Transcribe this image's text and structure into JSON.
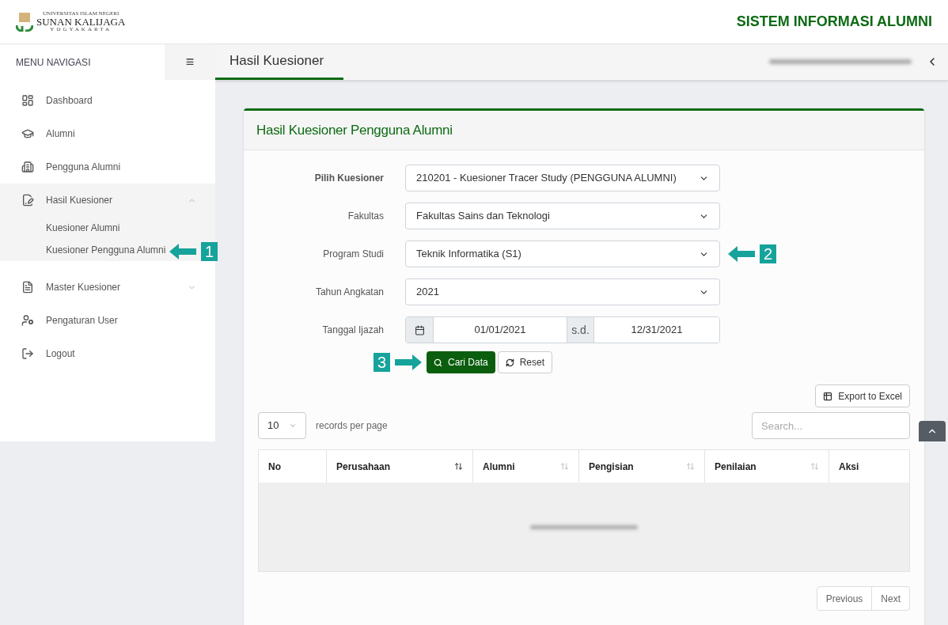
{
  "logo": {
    "line1": "UNIVERSITAS ISLAM NEGERI",
    "line2": "SUNAN KALIJAGA",
    "line3": "YOGYAKARTA"
  },
  "app_title": "SISTEM INFORMASI ALUMNI",
  "sidebar": {
    "heading": "MENU NAVIGASI",
    "toggle": "≡",
    "items": [
      {
        "label": "Dashboard",
        "kind": "item"
      },
      {
        "label": "Alumni",
        "kind": "item"
      },
      {
        "label": "Pengguna Alumni",
        "kind": "item"
      },
      {
        "label": "Hasil Kuesioner",
        "kind": "group",
        "expanded": true,
        "children": [
          {
            "label": "Kuesioner Alumni"
          },
          {
            "label": "Kuesioner Pengguna Alumni",
            "marker": "1"
          }
        ]
      },
      {
        "label": "Master Kuesioner",
        "kind": "group",
        "expanded": false
      },
      {
        "label": "Pengaturan User",
        "kind": "item"
      },
      {
        "label": "Logout",
        "kind": "item"
      }
    ]
  },
  "tab": {
    "label": "Hasil Kuesioner",
    "selected": true
  },
  "card": {
    "title": "Hasil Kuesioner Pengguna Alumni",
    "fields": [
      {
        "label": "Pilih Kuesioner",
        "value": "210201 - Kuesioner Tracer Study (PENGGUNA ALUMNI)",
        "bold": true
      },
      {
        "label": "Fakultas",
        "value": "Fakultas Sains dan Teknologi",
        "bold": false
      },
      {
        "label": "Program Studi",
        "value": "Teknik Informatika (S1)",
        "bold": false,
        "marker": "2"
      },
      {
        "label": "Tahun Angkatan",
        "value": "2021",
        "bold": false
      }
    ],
    "date": {
      "label": "Tanggal Ijazah",
      "from": "01/01/2021",
      "separator": "s.d.",
      "to": "12/31/2021"
    },
    "search_button": {
      "label": "Cari Data",
      "marker": "3"
    },
    "reset_button": "Reset",
    "export_button": "Export to Excel",
    "page_size": "10",
    "page_size_label": "records per page",
    "search": {
      "placeholder": "Search..."
    },
    "columns": [
      {
        "label": "No",
        "kind": "plain"
      },
      {
        "label": "Perusahaan",
        "kind": "sortable",
        "sorted": true
      },
      {
        "label": "Alumni",
        "kind": "sortable",
        "sorted": false
      },
      {
        "label": "Pengisian",
        "kind": "sortable",
        "sorted": false
      },
      {
        "label": "Penilaian",
        "kind": "sortable",
        "sorted": false
      },
      {
        "label": "Aksi",
        "kind": "plain"
      }
    ],
    "pager": [
      "Previous",
      "Next"
    ]
  }
}
